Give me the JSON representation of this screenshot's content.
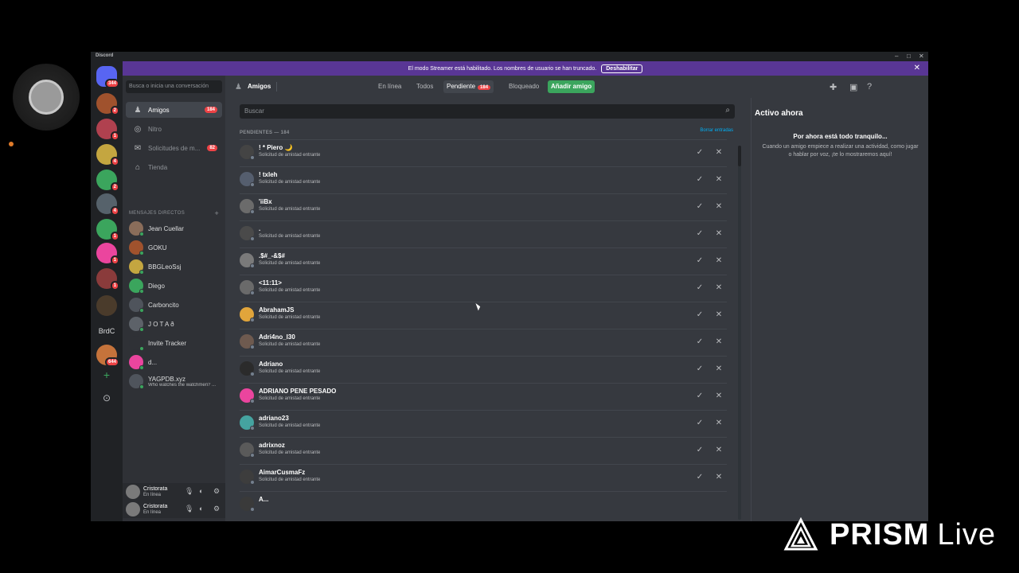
{
  "window": {
    "app_name": "Discord",
    "min": "–",
    "max": "□",
    "close": "✕"
  },
  "banner": {
    "text": "El modo Streamer está habilitado. Los nombres de usuario se han truncado.",
    "button": "Deshabilitar",
    "close": "✕"
  },
  "servers": [
    {
      "badge": "344",
      "color": "#5865f2",
      "type": "home"
    },
    {
      "badge": "2",
      "color": "#a0522d"
    },
    {
      "badge": "1",
      "color": "#b0414f"
    },
    {
      "badge": "4",
      "color": "#c4a640"
    },
    {
      "badge": "2",
      "color": "#3ba55d"
    },
    {
      "badge": "4",
      "color": "#56626b"
    },
    {
      "badge": "1",
      "color": "#3ba55d"
    },
    {
      "badge": "1",
      "color": "#eb459e"
    },
    {
      "badge": "1",
      "color": "#8a3b3b"
    },
    {
      "badge": "",
      "color": "#4a3b2b"
    },
    {
      "text": "BrdC"
    },
    {
      "badge": "644",
      "color": "#c5733b"
    }
  ],
  "server_actions": {
    "add": "+",
    "explore": "⊙"
  },
  "sidebar": {
    "search_placeholder": "Busca o inicia una conversación",
    "items": [
      {
        "label": "Amigos",
        "icon": "friends-icon",
        "count": "184",
        "active": true
      },
      {
        "label": "Nitro",
        "icon": "nitro-icon"
      },
      {
        "label": "Solicitudes de m...",
        "icon": "mail-icon",
        "count": "82"
      },
      {
        "label": "Tienda",
        "icon": "store-icon"
      }
    ],
    "dm_header": "MENSAJES DIRECTOS",
    "dm_add": "+",
    "dms": [
      {
        "name": "Jean Cuellar",
        "color": "#8a6d5a"
      },
      {
        "name": "GOKU",
        "color": "#a0522d"
      },
      {
        "name": "BBGLeoSsj",
        "color": "#c4a640"
      },
      {
        "name": "Diego",
        "color": "#3ba55d"
      },
      {
        "name": "Carboncito",
        "color": "#4f545c"
      },
      {
        "name": "J O T A ð",
        "color": "#5d6269"
      },
      {
        "name": "Invite Tracker",
        "color": "#2f3136"
      },
      {
        "name": "d...",
        "color": "#eb459e"
      },
      {
        "name": "YAGPDB.xyz",
        "sub": "Who watches the watchmen? ...",
        "color": "#4f545c"
      }
    ]
  },
  "user_panels": [
    {
      "name": "Cristorata",
      "status": "En línea"
    },
    {
      "name": "Cristorata",
      "status": "En línea"
    }
  ],
  "topbar": {
    "title": "Amigos",
    "tabs": [
      {
        "label": "En línea"
      },
      {
        "label": "Todos"
      },
      {
        "label": "Pendiente",
        "count": "184",
        "active": true
      },
      {
        "label": "Bloqueado"
      },
      {
        "label": "Añadir amigo",
        "add": true
      }
    ]
  },
  "main": {
    "search_placeholder": "Buscar",
    "section_header": "PENDIENTES — 184",
    "clear_link": "Borrar entradas",
    "rows": [
      {
        "name": "! * Piero 🌙",
        "sub": "Solicitud de amistad entrante",
        "color": "#444"
      },
      {
        "name": "! txleh",
        "sub": "Solicitud de amistad entrante",
        "color": "#555e6e"
      },
      {
        "name": "'iiBx",
        "sub": "Solicitud de amistad entrante",
        "color": "#6b6b6b"
      },
      {
        "name": ".",
        "sub": "Solicitud de amistad entrante",
        "color": "#4a4a4a"
      },
      {
        "name": ".$#_-&$#",
        "sub": "Solicitud de amistad entrante",
        "color": "#7a7a7a"
      },
      {
        "name": "<11:11>",
        "sub": "Solicitud de amistad entrante",
        "color": "#6a6a6a"
      },
      {
        "name": "AbrahamJS",
        "sub": "Solicitud de amistad entrante",
        "color": "#e1a53b"
      },
      {
        "name": "Adri4no_l30",
        "sub": "Solicitud de amistad entrante",
        "color": "#6e5a4f"
      },
      {
        "name": "Adriano",
        "sub": "Solicitud de amistad entrante",
        "color": "#2b2b2b"
      },
      {
        "name": "ADRIANO PENE PESADO",
        "sub": "Solicitud de amistad entrante",
        "color": "#eb459e"
      },
      {
        "name": "adriano23",
        "sub": "Solicitud de amistad entrante",
        "color": "#45a3a0"
      },
      {
        "name": "adrixnoz",
        "sub": "Solicitud de amistad entrante",
        "color": "#5a5a5a"
      },
      {
        "name": "AimarCusmaFz",
        "sub": "Solicitud de amistad entrante",
        "color": "#3d3d3d"
      },
      {
        "name": "A...",
        "sub": "",
        "color": "#3a3a3a"
      }
    ]
  },
  "active_now": {
    "header": "Activo ahora",
    "title": "Por ahora está todo tranquilo...",
    "desc": "Cuando un amigo empiece a realizar una actividad, como jugar o hablar por voz, ¡te lo mostraremos aquí!"
  },
  "watermark": {
    "brand": "PRISM",
    "suffix": "Live"
  }
}
